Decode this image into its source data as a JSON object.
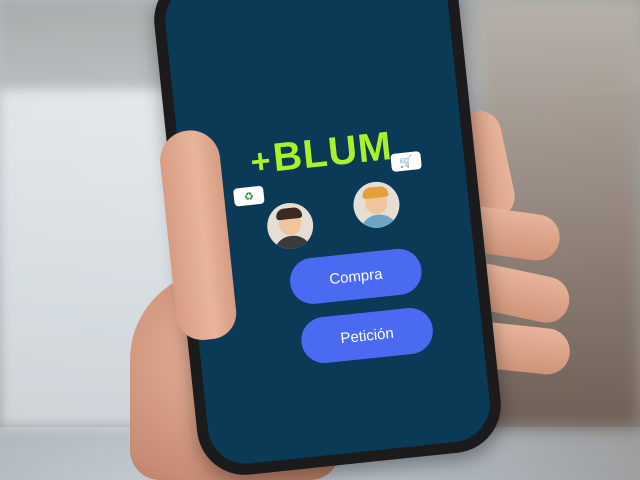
{
  "app": {
    "logo": {
      "plus": "+",
      "name": "BLUM"
    },
    "bubbles": [
      {
        "icon": "recycle-icon",
        "glyph": "♻"
      },
      {
        "icon": "cart-icon",
        "glyph": "🛒"
      }
    ],
    "avatars": [
      {
        "name": "avatar-dark-hair"
      },
      {
        "name": "avatar-blonde"
      }
    ],
    "buttons": {
      "compra": "Compra",
      "peticion": "Petición"
    }
  },
  "colors": {
    "screen_bg": "#0b3a57",
    "logo": "#a9f22b",
    "button": "#4a6af2"
  }
}
